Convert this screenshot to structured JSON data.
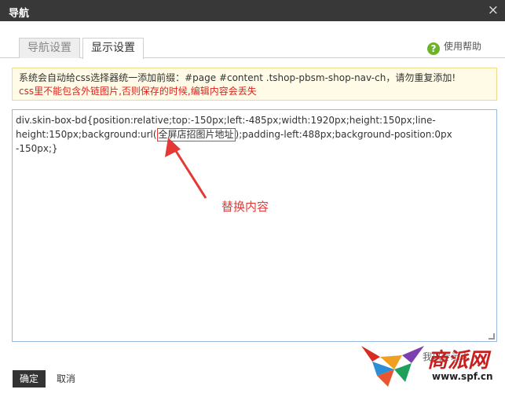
{
  "dialog": {
    "title": "导航",
    "close_glyph": "×"
  },
  "tabs": [
    {
      "label": "导航设置",
      "active": false
    },
    {
      "label": "显示设置",
      "active": true
    }
  ],
  "help": {
    "label": "使用帮助",
    "icon": "?"
  },
  "notice": {
    "line1": "系统会自动给css选择器统一添加前缀：#page #content .tshop-pbsm-shop-nav-ch，请勿重复添加!",
    "line2": "css里不能包含外链图片,否则保存的时候,编辑内容会丢失"
  },
  "editor": {
    "code_before": "div.skin-box-bd{position:relative;top:-150px;left:-485px;width:1920px;height:150px;line-height:150px;background:url(",
    "code_marked": "全屏店招图片地址",
    "code_after": ");padding-left:488px;background-position:0px -150px;}"
  },
  "annotation": {
    "label": "替换内容",
    "color": "#e53935"
  },
  "buttons": {
    "ok": "确定",
    "cancel": "取消"
  },
  "partial_text": "我以专示人",
  "watermark": {
    "brand": "商派网",
    "site": "www.spf.cn"
  }
}
